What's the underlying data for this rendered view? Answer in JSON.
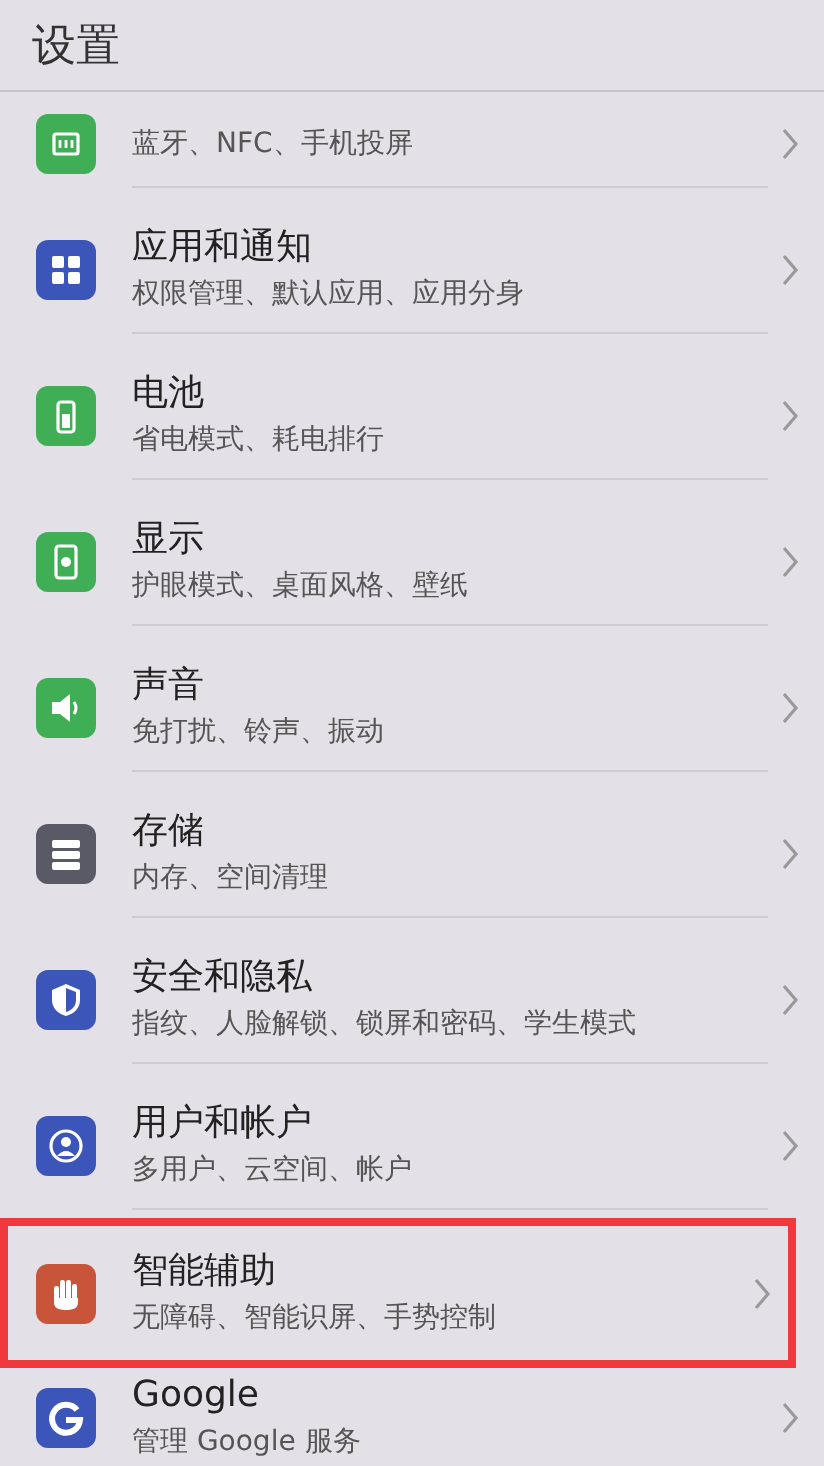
{
  "header": {
    "title": "设置"
  },
  "items": [
    {
      "subtitle": "蓝牙、NFC、手机投屏",
      "color": "#3fae55",
      "highlighted": false
    },
    {
      "title": "应用和通知",
      "subtitle": "权限管理、默认应用、应用分身",
      "color": "#3c55b8",
      "highlighted": false
    },
    {
      "title": "电池",
      "subtitle": "省电模式、耗电排行",
      "color": "#3fae55",
      "highlighted": false
    },
    {
      "title": "显示",
      "subtitle": "护眼模式、桌面风格、壁纸",
      "color": "#3fae55",
      "highlighted": false
    },
    {
      "title": "声音",
      "subtitle": "免打扰、铃声、振动",
      "color": "#3fae55",
      "highlighted": false
    },
    {
      "title": "存储",
      "subtitle": "内存、空间清理",
      "color": "#5a5a66",
      "highlighted": false
    },
    {
      "title": "安全和隐私",
      "subtitle": "指纹、人脸解锁、锁屏和密码、学生模式",
      "color": "#3c55b8",
      "highlighted": false
    },
    {
      "title": "用户和帐户",
      "subtitle": "多用户、云空间、帐户",
      "color": "#3c55b8",
      "highlighted": false
    },
    {
      "title": "智能辅助",
      "subtitle": "无障碍、智能识屏、手势控制",
      "color": "#c8553a",
      "highlighted": true
    },
    {
      "title": "Google",
      "subtitle": "管理 Google 服务",
      "color": "#3c55b8",
      "highlighted": false
    }
  ]
}
